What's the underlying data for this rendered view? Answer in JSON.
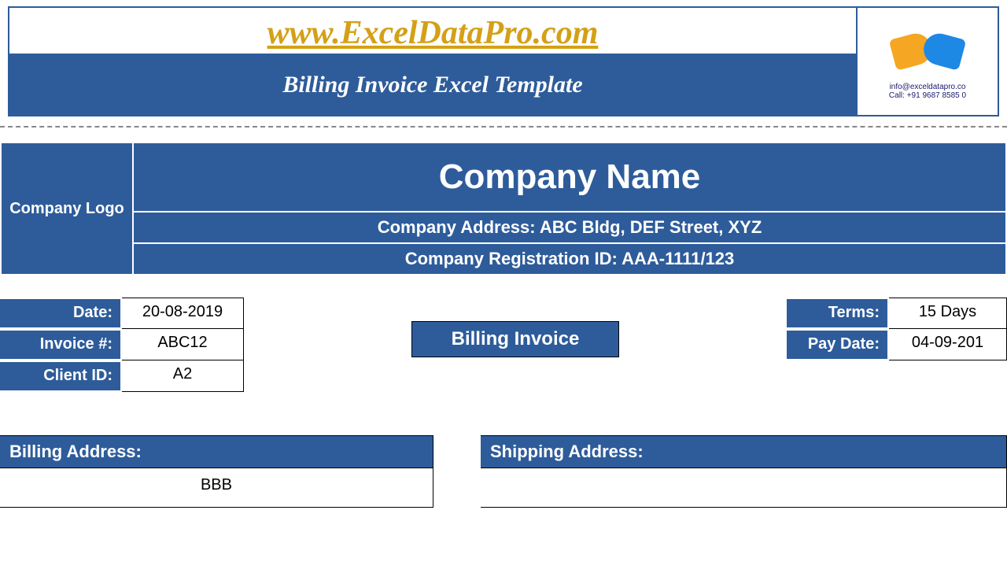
{
  "banner": {
    "url": "www.ExcelDataPro.com",
    "subtitle": "Billing Invoice Excel Template",
    "contact_email": "info@exceldatapro.co",
    "contact_phone": "Call: +91 9687 8585 0"
  },
  "company": {
    "logo_label": "Company Logo",
    "name": "Company Name",
    "address": "Company Address: ABC Bldg, DEF Street, XYZ",
    "registration": "Company Registration ID: AAA-1111/123"
  },
  "meta_left": {
    "date_label": "Date:",
    "date_value": "20-08-2019",
    "invoice_label": "Invoice #:",
    "invoice_value": "ABC12",
    "client_label": "Client ID:",
    "client_value": "A2"
  },
  "center_title": "Billing Invoice",
  "meta_right": {
    "terms_label": "Terms:",
    "terms_value": "15 Days",
    "paydate_label": "Pay Date:",
    "paydate_value": "04-09-201"
  },
  "addresses": {
    "billing_label": "Billing Address:",
    "billing_value": "BBB",
    "shipping_label": "Shipping Address:",
    "shipping_value": ""
  }
}
